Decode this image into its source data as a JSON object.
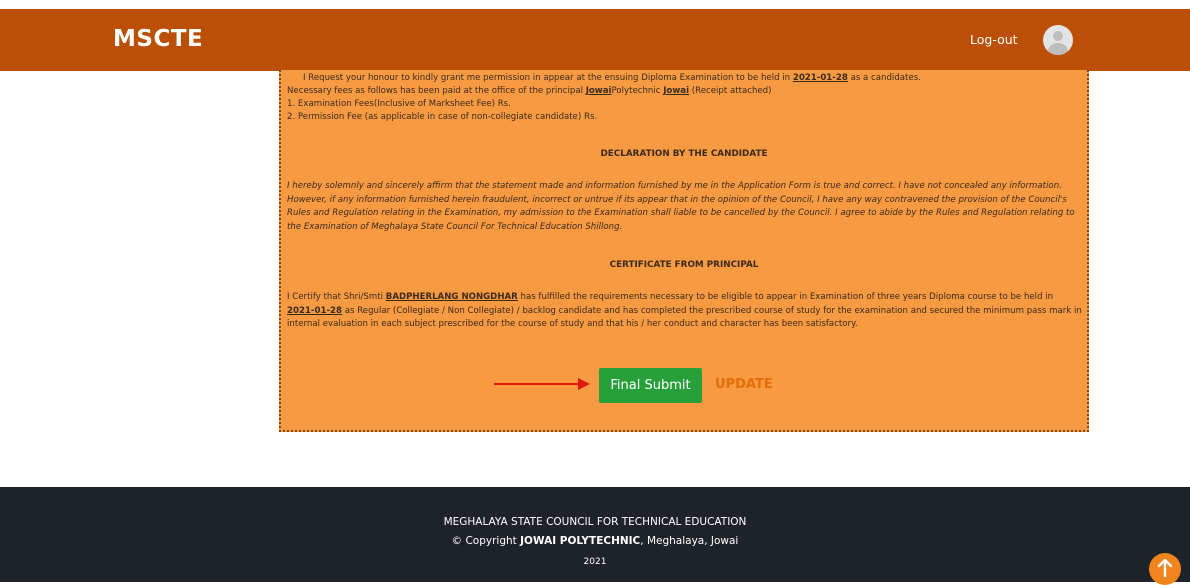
{
  "header": {
    "brand": "MSCTE",
    "logout_label": "Log-out"
  },
  "form": {
    "request": {
      "l1_pre": "I Request your honour to kindly grant me permission in appear at the ensuing Diploma Examination to be held in",
      "exam_date": "2021-01-28",
      "l1_post": "as a candidates.",
      "l2_pre": "Necessary fees as follows has been paid at the office of the principal",
      "institute": "Jowai",
      "l2_mid": "Polytechnic",
      "place": "Jowai",
      "l2_post": "(Receipt attached)",
      "l3": "1. Examination Fees(Inclusive of Marksheet Fee) Rs.",
      "l4": "2. Permission Fee (as applicable in case of non-collegiate candidate) Rs."
    },
    "declaration": {
      "heading": "DECLARATION BY THE CANDIDATE",
      "text": "I hereby solemnly and sincerely affirm that the statement made and information furnished by me in the Application Form is true and correct. I have not concealed any information. However, if any information furnished herein fraudulent, incorrect or untrue if its appear that in the opinion of the Council, I have any way contravened the provision of the Council's Rules and Regulation relating in the Examination, my admission to the Examination shall liable to be cancelled by the Council. I agree to abide by the Rules and Regulation relating to the Examination of Meghalaya State Council For Technical Education Shillong."
    },
    "certificate": {
      "heading": "CERTIFICATE FROM PRINCIPAL",
      "pre": "I Certify that Shri/Smti",
      "candidate": "BADPHERLANG NONGDHAR",
      "mid1": "has fulfilled the requirements necessary to be eligible to appear in Examination of three years Diploma course to be held in",
      "date": "2021-01-28",
      "post": "as Regular (Collegiate / Non Collegiate) / backlog candidate and has completed the prescribed course of study for the examination and secured the minimum pass mark in internal evaluation in each subject prescribed for the course of study and that his / her conduct and character has been satisfactory."
    },
    "submit_label": "Final Submit",
    "update_label": "UPDATE"
  },
  "footer": {
    "line1": "MEGHALAYA STATE COUNCIL FOR TECHNICAL EDUCATION",
    "copyright_prefix": "© Copyright",
    "institution": "JOWAI POLYTECHNIC",
    "copyright_suffix": ", Meghalaya, Jowai",
    "year": "2021"
  },
  "colors": {
    "navbar": "#bb4f05",
    "form_bg": "#f79a42",
    "submit": "#27a03a",
    "update": "#e56d08",
    "footer": "#1e2329",
    "arrow": "#e0190f"
  }
}
